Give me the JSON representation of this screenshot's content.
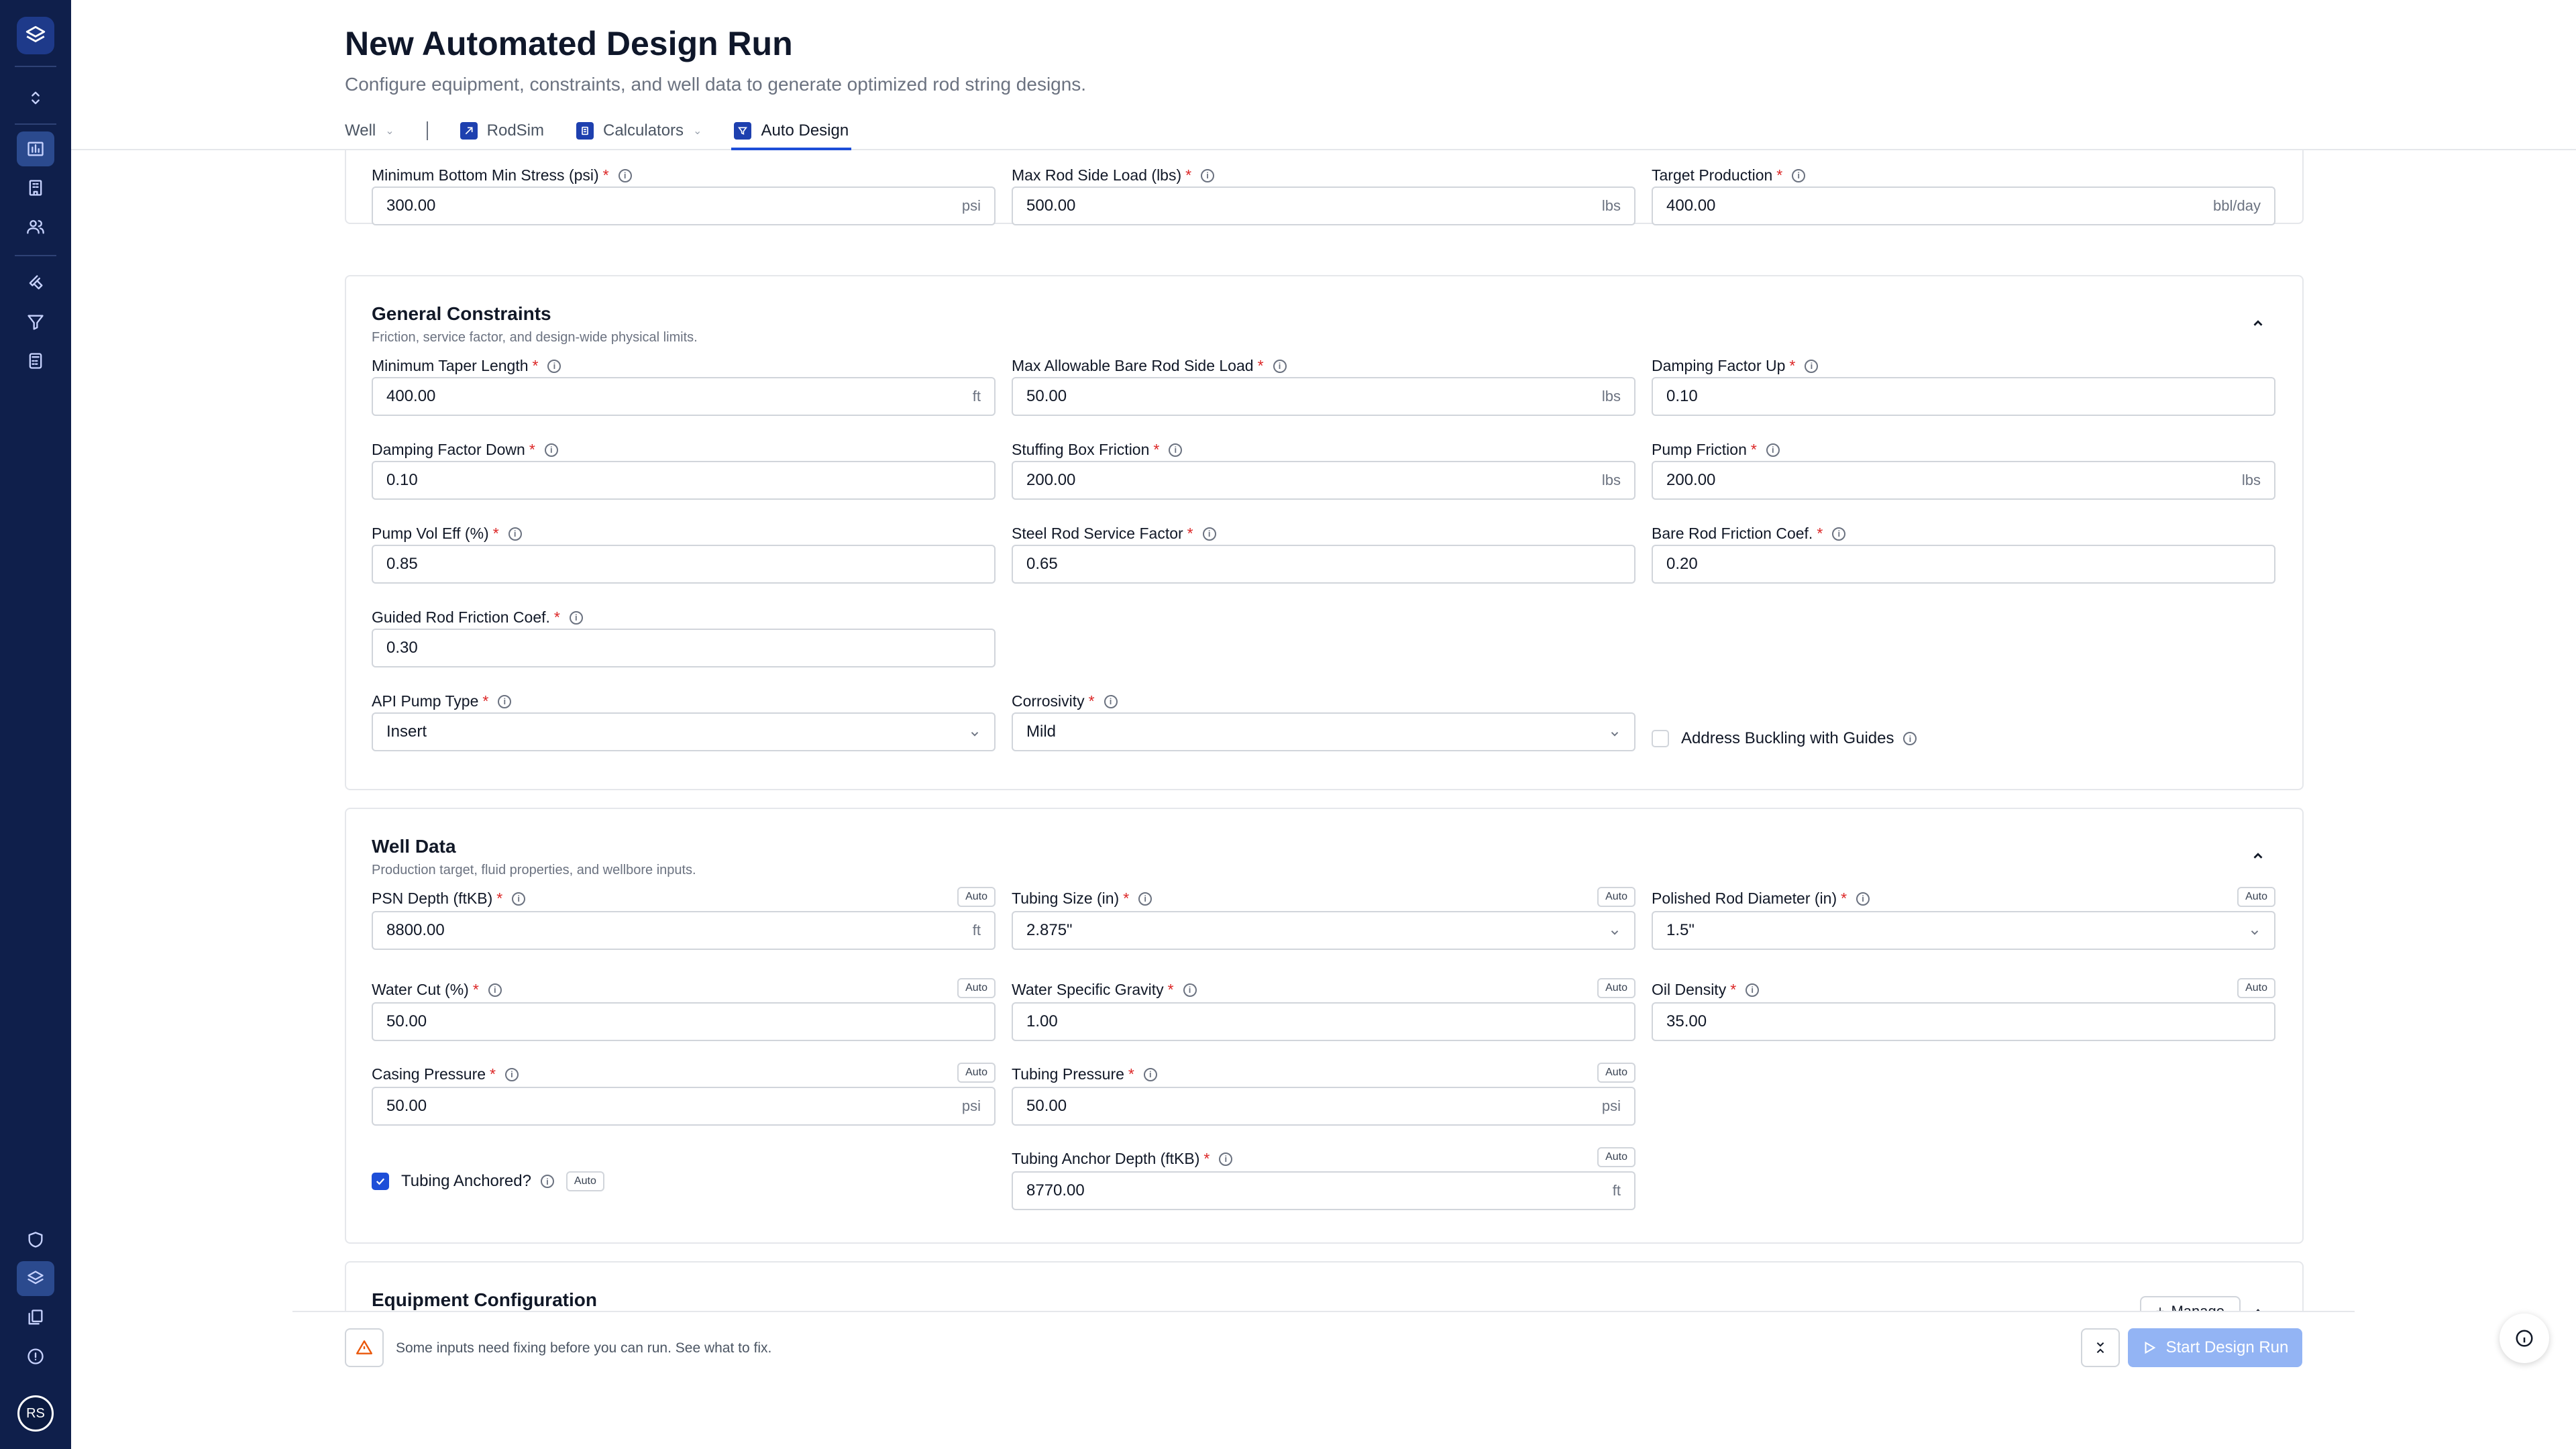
{
  "header": {
    "title": "New Automated Design Run",
    "subtitle": "Configure equipment, constraints, and well data to generate optimized rod string designs.",
    "tabs": [
      {
        "label": "Well"
      },
      {
        "label": "RodSim"
      },
      {
        "label": "Calculators"
      },
      {
        "label": "Auto Design"
      }
    ],
    "active_tab": "Auto Design"
  },
  "user": {
    "initials": "RS"
  },
  "design_targets": {
    "fields": [
      {
        "label": "Minimum Bottom Min Stress (psi)",
        "value": "300.00",
        "unit": "psi",
        "required": true
      },
      {
        "label": "Max Rod Side Load (lbs)",
        "value": "500.00",
        "unit": "lbs",
        "required": true
      },
      {
        "label": "Target Production",
        "value": "400.00",
        "unit": "bbl/day",
        "required": true
      }
    ]
  },
  "general_constraints": {
    "title": "General Constraints",
    "description": "Friction, service factor, and design-wide physical limits.",
    "fields": [
      {
        "label": "Minimum Taper Length",
        "value": "400.00",
        "unit": "ft",
        "required": true
      },
      {
        "label": "Max Allowable Bare Rod Side Load",
        "value": "50.00",
        "unit": "lbs",
        "required": true
      },
      {
        "label": "Damping Factor Up",
        "value": "0.10",
        "unit": "",
        "required": true
      },
      {
        "label": "Damping Factor Down",
        "value": "0.10",
        "unit": "",
        "required": true
      },
      {
        "label": "Stuffing Box Friction",
        "value": "200.00",
        "unit": "lbs",
        "required": true
      },
      {
        "label": "Pump Friction",
        "value": "200.00",
        "unit": "lbs",
        "required": true
      },
      {
        "label": "Pump Vol Eff (%)",
        "value": "0.85",
        "unit": "",
        "required": true
      },
      {
        "label": "Steel Rod Service Factor",
        "value": "0.65",
        "unit": "",
        "required": true
      },
      {
        "label": "Bare Rod Friction Coef.",
        "value": "0.20",
        "unit": "",
        "required": true
      },
      {
        "label": "Guided Rod Friction Coef.",
        "value": "0.30",
        "unit": "",
        "required": true
      },
      {
        "label": "API Pump Type",
        "value": "Insert",
        "unit": "",
        "required": true
      },
      {
        "label": "Corrosivity",
        "value": "Mild",
        "unit": "",
        "required": true
      }
    ],
    "buckling": {
      "label": "Address Buckling with Guides",
      "checked": false
    }
  },
  "well_data": {
    "title": "Well Data",
    "description": "Production target, fluid properties, and wellbore inputs.",
    "auto_label": "Auto",
    "fields": [
      {
        "label": "PSN Depth (ftKB)",
        "value": "8800.00",
        "unit": "ft",
        "required": true
      },
      {
        "label": "Tubing Size (in)",
        "value": "2.875\"",
        "unit": "",
        "required": true
      },
      {
        "label": "Polished Rod Diameter (in)",
        "value": "1.5\"",
        "unit": "",
        "required": true
      },
      {
        "label": "Water Cut (%)",
        "value": "50.00",
        "unit": "",
        "required": true
      },
      {
        "label": "Water Specific Gravity",
        "value": "1.00",
        "unit": "",
        "required": true
      },
      {
        "label": "Oil Density",
        "value": "35.00",
        "unit": "",
        "required": true
      },
      {
        "label": "Casing Pressure",
        "value": "50.00",
        "unit": "psi",
        "required": true
      },
      {
        "label": "Tubing Pressure",
        "value": "50.00",
        "unit": "psi",
        "required": true
      },
      {
        "label": "Tubing Anchor Depth (ftKB)",
        "value": "8770.00",
        "unit": "ft",
        "required": true
      }
    ],
    "tubing_anchored": {
      "label": "Tubing Anchored?",
      "checked": true
    }
  },
  "equipment": {
    "title": "Equipment Configuration",
    "manage_label": "Manage"
  },
  "footer": {
    "warning": "Some inputs need fixing before you can run. See what to fix.",
    "start_label": "Start Design Run"
  },
  "colors": {
    "sidebar": "#0f1f4b",
    "accent": "#1d4ed8",
    "required": "#dc2626",
    "warning": "#ea580c",
    "start_disabled": "#93b4f4"
  }
}
